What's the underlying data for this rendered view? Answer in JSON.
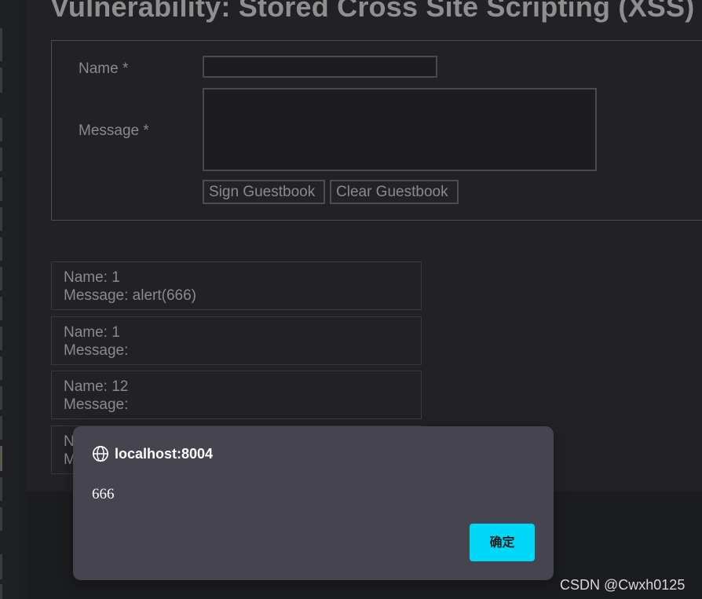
{
  "page": {
    "title": "Vulnerability: Stored Cross Site Scripting (XSS)"
  },
  "form": {
    "name_label": "Name *",
    "message_label": "Message *",
    "name_value": "",
    "message_value": "",
    "sign_button": "Sign Guestbook",
    "clear_button": "Clear Guestbook"
  },
  "guestbook": {
    "entries": [
      {
        "name": "Name: 1",
        "message": "Message: alert(666)"
      },
      {
        "name": "Name: 1",
        "message": "Message:"
      },
      {
        "name": "Name: 12",
        "message": "Message:"
      },
      {
        "name": "N",
        "message": "M"
      }
    ]
  },
  "alert": {
    "origin": "localhost:8004",
    "origin_icon": "globe-icon",
    "message": "666",
    "ok_label": "确定",
    "ok_color": "#00d8f8"
  },
  "watermark": "CSDN @Cwxh0125"
}
